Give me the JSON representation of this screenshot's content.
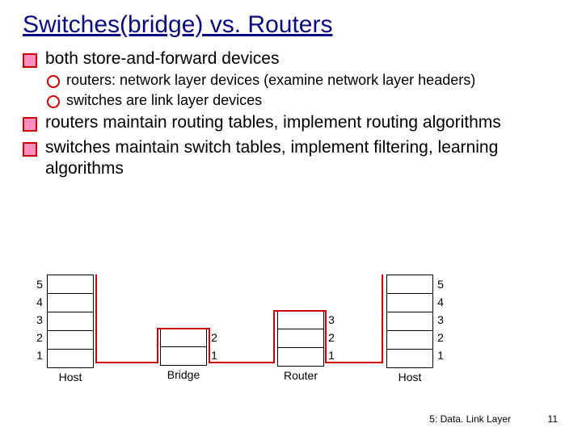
{
  "title": "Switches(bridge) vs. Routers",
  "bullets": {
    "b1a": "both store-and-forward devices",
    "b2a": "routers: network layer devices (examine network layer headers)",
    "b2b": "switches are link layer devices",
    "b1b": "routers maintain routing tables, implement routing algorithms",
    "b1c": "switches maintain switch tables, implement filtering, learning algorithms"
  },
  "diagram": {
    "layers": {
      "l5": "5",
      "l4": "4",
      "l3": "3",
      "l2": "2",
      "l1": "1"
    },
    "labels": {
      "host_l": "Host",
      "bridge": "Bridge",
      "router": "Router",
      "host_r": "Host"
    }
  },
  "footer": {
    "section": "5: Data. Link Layer",
    "page": "11"
  }
}
